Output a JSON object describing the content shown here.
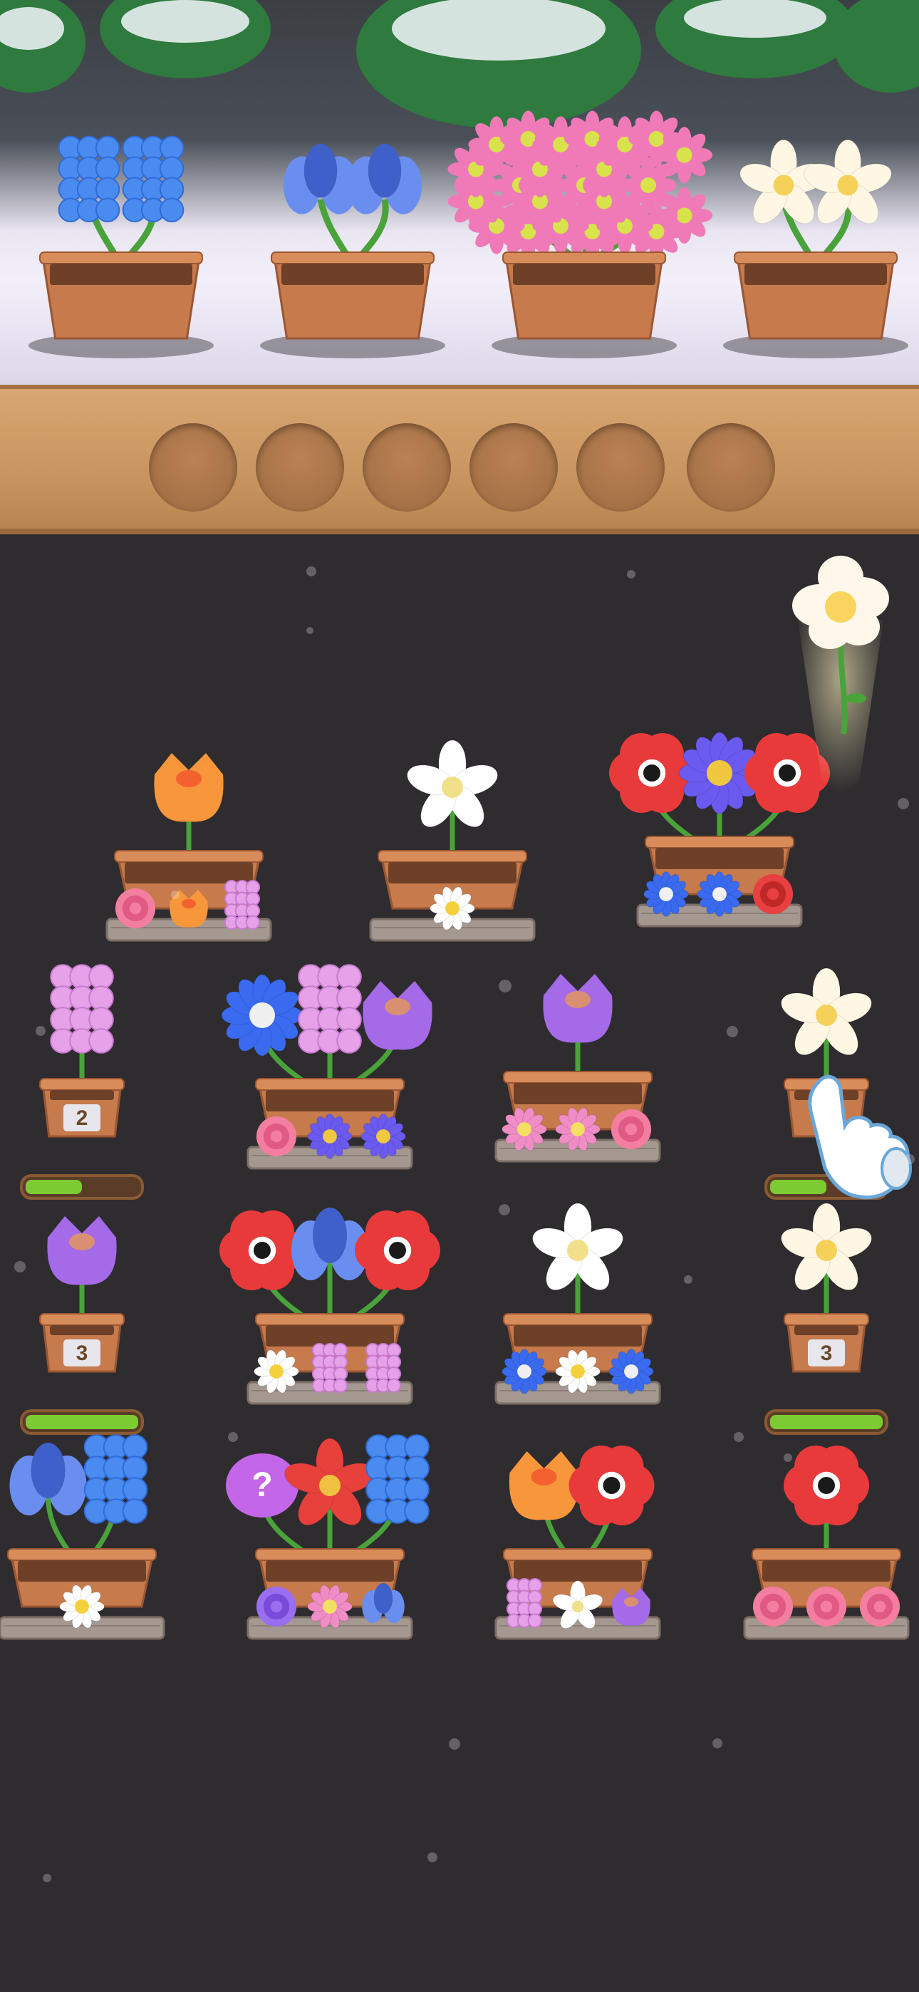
{
  "colors": {
    "background": "#2f2c2f",
    "tray": "#c99560",
    "pot": "#c77a4c",
    "progress_fill": "#7ccb32"
  },
  "top_shelf": {
    "pots": [
      {
        "flower": "blue-hyacinth",
        "count": 2
      },
      {
        "flower": "blue-iris",
        "count": 2
      },
      {
        "flower": "pink-daisy-bouquet",
        "count": 3
      },
      {
        "flower": "white-plumeria",
        "count": 2
      }
    ]
  },
  "collection_tray": {
    "empty_slots": 6
  },
  "floating_flower": {
    "flower": "white-plumeria"
  },
  "board": {
    "row1": [
      {
        "top": [
          "orange-tulip"
        ],
        "tray": [
          "pink-rose",
          "orange-tulip",
          "pink-hyacinth"
        ]
      },
      {
        "top": [
          "white-lily"
        ],
        "tray": [
          "white-daisy"
        ]
      },
      {
        "top": [
          "red-anemone",
          "purple-aster",
          "red-anemone"
        ],
        "tray": [
          "blue-cornflower",
          "blue-cornflower",
          "red-rose"
        ]
      }
    ],
    "row2": [
      {
        "top": [
          "pink-hyacinth"
        ],
        "level": "2",
        "progress": 0.5
      },
      {
        "top": [
          "blue-cornflower",
          "pink-hyacinth",
          "purple-tulip"
        ],
        "tray": [
          "pink-rose",
          "purple-aster",
          "purple-aster"
        ]
      },
      {
        "top": [
          "purple-tulip"
        ],
        "tray": [
          "pink-daisy",
          "pink-daisy",
          "pink-rose"
        ]
      },
      {
        "top": [
          "white-plumeria"
        ],
        "level": "",
        "progress": 0.5
      }
    ],
    "row3": [
      {
        "top": [
          "purple-tulip"
        ],
        "level": "3",
        "progress": 1.0
      },
      {
        "top": [
          "red-anemone",
          "blue-iris",
          "red-anemone"
        ],
        "tray": [
          "white-daisy",
          "pink-hyacinth",
          "pink-hyacinth"
        ]
      },
      {
        "top": [
          "white-lily"
        ],
        "tray": [
          "blue-cornflower",
          "white-daisy",
          "blue-cornflower"
        ]
      },
      {
        "top": [
          "white-plumeria"
        ],
        "level": "3",
        "progress": 1.0
      }
    ],
    "row4": [
      {
        "top": [
          "blue-iris",
          "blue-hyacinth"
        ],
        "tray": [
          "white-daisy"
        ]
      },
      {
        "top": [
          "mystery",
          "red-lily",
          "blue-hyacinth"
        ],
        "tray": [
          "purple-rose",
          "pink-daisy",
          "blue-iris"
        ]
      },
      {
        "top": [
          "orange-tulip",
          "red-anemone"
        ],
        "tray": [
          "pink-hyacinth",
          "white-lily",
          "purple-tulip"
        ]
      },
      {
        "top": [
          "red-anemone"
        ],
        "tray": [
          "pink-rose",
          "pink-rose",
          "pink-rose"
        ]
      }
    ]
  },
  "mystery_label": "?"
}
